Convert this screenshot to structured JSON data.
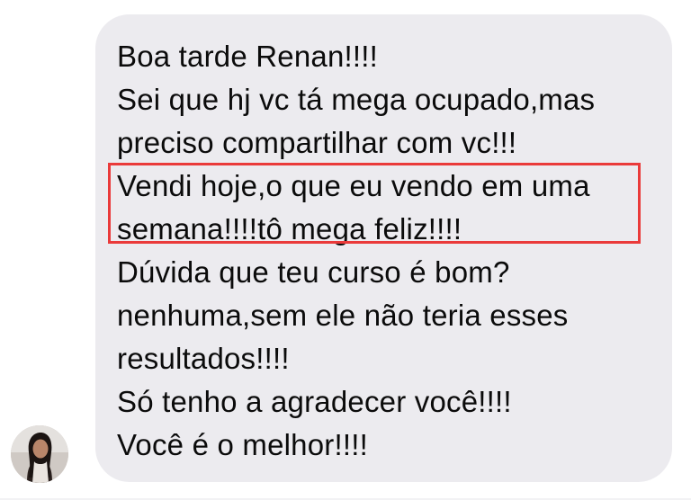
{
  "conversation": {
    "message": {
      "lines": [
        "Boa tarde Renan!!!!",
        "Sei que hj vc tá mega ocupado,mas",
        "preciso compartilhar com vc!!!",
        "Vendi hoje,o que eu vendo em uma",
        "semana!!!!tô mega feliz!!!!",
        "Dúvida que teu curso é bom?",
        "nenhuma,sem ele não teria esses",
        "resultados!!!!",
        "Só tenho a agradecer você!!!!",
        "Você é o melhor!!!!"
      ],
      "highlighted_lines": [
        4,
        5
      ]
    },
    "sender": {
      "avatar": "user-avatar-photo"
    }
  },
  "colors": {
    "bubble_background": "#ecebef",
    "text": "#0b0b0b",
    "highlight_border": "#ea3a3a",
    "page_background": "#ffffff"
  }
}
